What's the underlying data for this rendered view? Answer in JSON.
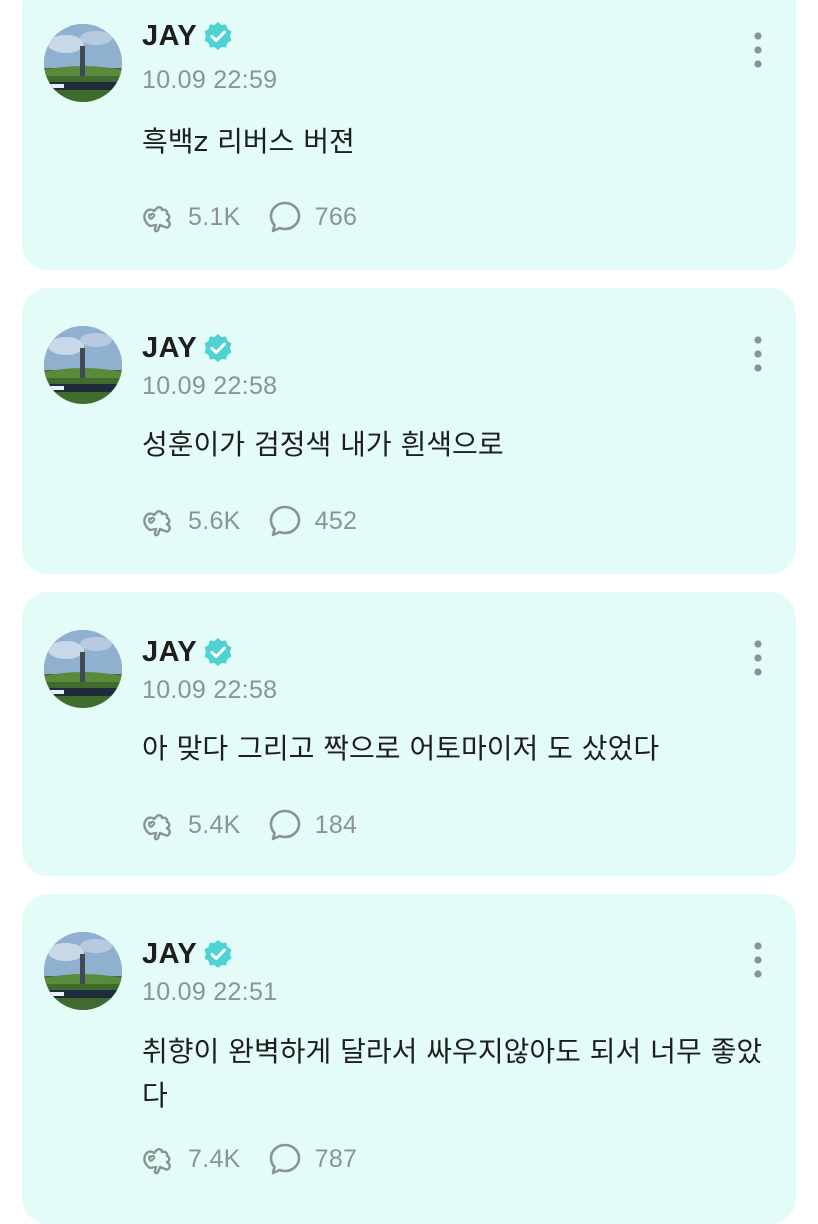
{
  "posts": [
    {
      "author": "JAY",
      "time": "10.09 22:59",
      "text": "흑백z 리버스 버젼",
      "likes": "5.1K",
      "comments": "766"
    },
    {
      "author": "JAY",
      "time": "10.09 22:58",
      "text": "성훈이가 검정색 내가 흰색으로",
      "likes": "5.6K",
      "comments": "452"
    },
    {
      "author": "JAY",
      "time": "10.09 22:58",
      "text": "아 맞다 그리고 짝으로 어토마이저 도 샀었다",
      "likes": "5.4K",
      "comments": "184"
    },
    {
      "author": "JAY",
      "time": "10.09 22:51",
      "text": "취향이 완벽하게 달라서 싸우지않아도 되서 너무 좋았다",
      "likes": "7.4K",
      "comments": "787"
    }
  ],
  "colors": {
    "card_bg": "#e3fcf7",
    "verified": "#4fd2d2",
    "muted": "#8c9492",
    "text": "#1e1e1e"
  },
  "icons": {
    "like": "hand-heart-icon",
    "comment": "speech-bubble-icon",
    "verified": "verified-badge-icon",
    "more": "more-vertical-icon"
  }
}
